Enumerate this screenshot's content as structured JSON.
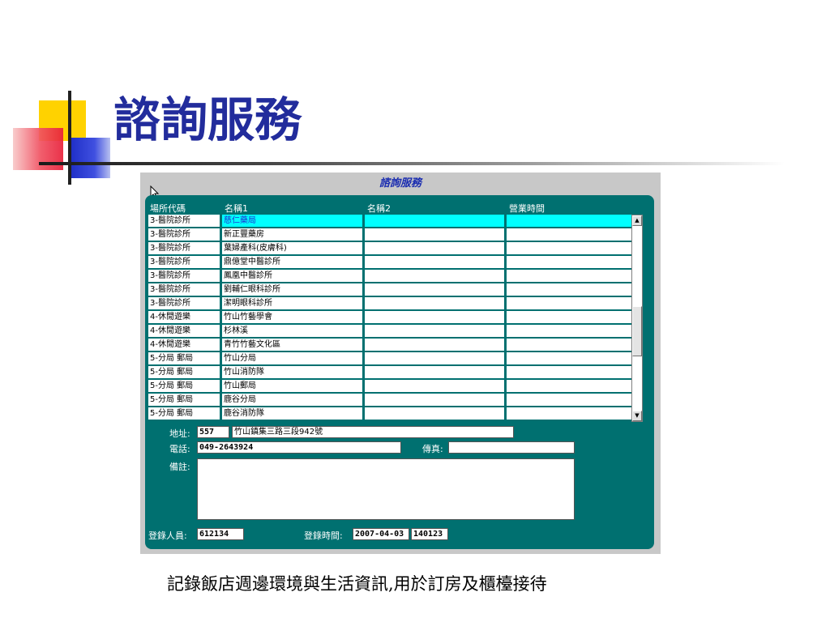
{
  "slide": {
    "title": "諮詢服務",
    "caption": "記錄飯店週邊環境與生活資訊,用於訂房及櫃檯接待"
  },
  "form": {
    "title": "諮詢服務",
    "columns": [
      "場所代碼",
      "名稱1",
      "名稱2",
      "營業時間"
    ],
    "rows": [
      {
        "code": "3-醫院診所",
        "name1": "慈仁藥局",
        "name2": "",
        "hours": "",
        "selected": true
      },
      {
        "code": "3-醫院診所",
        "name1": "新正豐藥房",
        "name2": "",
        "hours": ""
      },
      {
        "code": "3-醫院診所",
        "name1": "葉婦產科(皮膚科)",
        "name2": "",
        "hours": ""
      },
      {
        "code": "3-醫院診所",
        "name1": "鼎億堂中醫診所",
        "name2": "",
        "hours": ""
      },
      {
        "code": "3-醫院診所",
        "name1": "鳳凰中醫診所",
        "name2": "",
        "hours": ""
      },
      {
        "code": "3-醫院診所",
        "name1": "劉輔仁眼科診所",
        "name2": "",
        "hours": ""
      },
      {
        "code": "3-醫院診所",
        "name1": "潔明眼科診所",
        "name2": "",
        "hours": ""
      },
      {
        "code": "4-休閒遊樂",
        "name1": "竹山竹藝學會",
        "name2": "",
        "hours": ""
      },
      {
        "code": "4-休閒遊樂",
        "name1": "杉林溪",
        "name2": "",
        "hours": ""
      },
      {
        "code": "4-休閒遊樂",
        "name1": "青竹竹藝文化區",
        "name2": "",
        "hours": ""
      },
      {
        "code": "5-分局 郵局",
        "name1": "竹山分局",
        "name2": "",
        "hours": ""
      },
      {
        "code": "5-分局 郵局",
        "name1": "竹山消防隊",
        "name2": "",
        "hours": ""
      },
      {
        "code": "5-分局 郵局",
        "name1": "竹山郵局",
        "name2": "",
        "hours": ""
      },
      {
        "code": "5-分局 郵局",
        "name1": "鹿谷分局",
        "name2": "",
        "hours": ""
      },
      {
        "code": "5-分局 郵局",
        "name1": "鹿谷消防隊",
        "name2": "",
        "hours": ""
      }
    ],
    "labels": {
      "address": "地址:",
      "phone": "電話:",
      "fax": "傳真:",
      "remarks": "備註:",
      "login_user": "登錄人員:",
      "login_time": "登錄時間:"
    },
    "values": {
      "zip": "557",
      "address": "竹山鎮集三路三段942號",
      "phone": "049-2643924",
      "fax": "",
      "remarks": "",
      "login_user": "612134",
      "login_date": "2007-04-03",
      "login_time": "140123"
    },
    "icons": {
      "scroll_up": "▲",
      "scroll_down": "▼"
    },
    "colors": {
      "panel": "#007070",
      "selected_row": "#00ffff",
      "title_blue": "#222c9c"
    }
  }
}
